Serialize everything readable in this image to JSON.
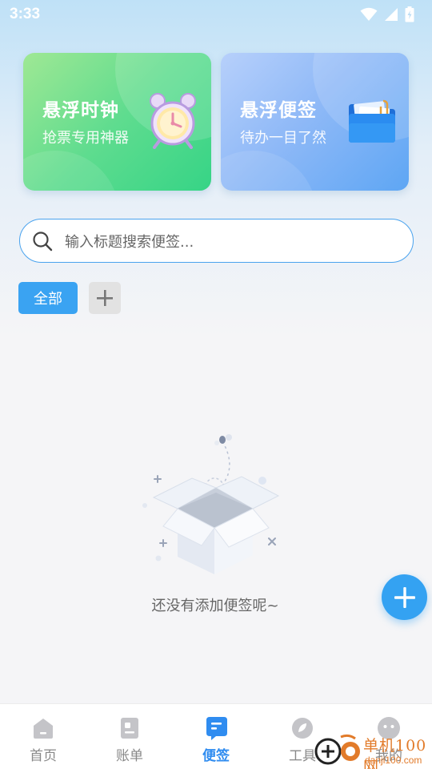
{
  "status_bar": {
    "time": "3:33"
  },
  "cards": [
    {
      "title": "悬浮时钟",
      "subtitle": "抢票专用神器",
      "icon": "alarm-clock-icon"
    },
    {
      "title": "悬浮便签",
      "subtitle": "待办一目了然",
      "icon": "folder-note-icon"
    }
  ],
  "search": {
    "placeholder": "输入标题搜索便签..."
  },
  "categories": {
    "all_label": "全部"
  },
  "empty_state": {
    "message": "还没有添加便签呢~"
  },
  "bottom_nav": [
    {
      "label": "首页",
      "icon": "home-icon",
      "active": false
    },
    {
      "label": "账单",
      "icon": "bill-icon",
      "active": false
    },
    {
      "label": "便签",
      "icon": "note-icon",
      "active": true
    },
    {
      "label": "工具",
      "icon": "tool-icon",
      "active": false
    },
    {
      "label": "我的",
      "icon": "profile-icon",
      "active": false
    }
  ],
  "watermark": {
    "brand": "单机100网",
    "url": "danji100.com"
  },
  "colors": {
    "accent": "#3aa3f2",
    "active_nav": "#2f8cf0"
  }
}
